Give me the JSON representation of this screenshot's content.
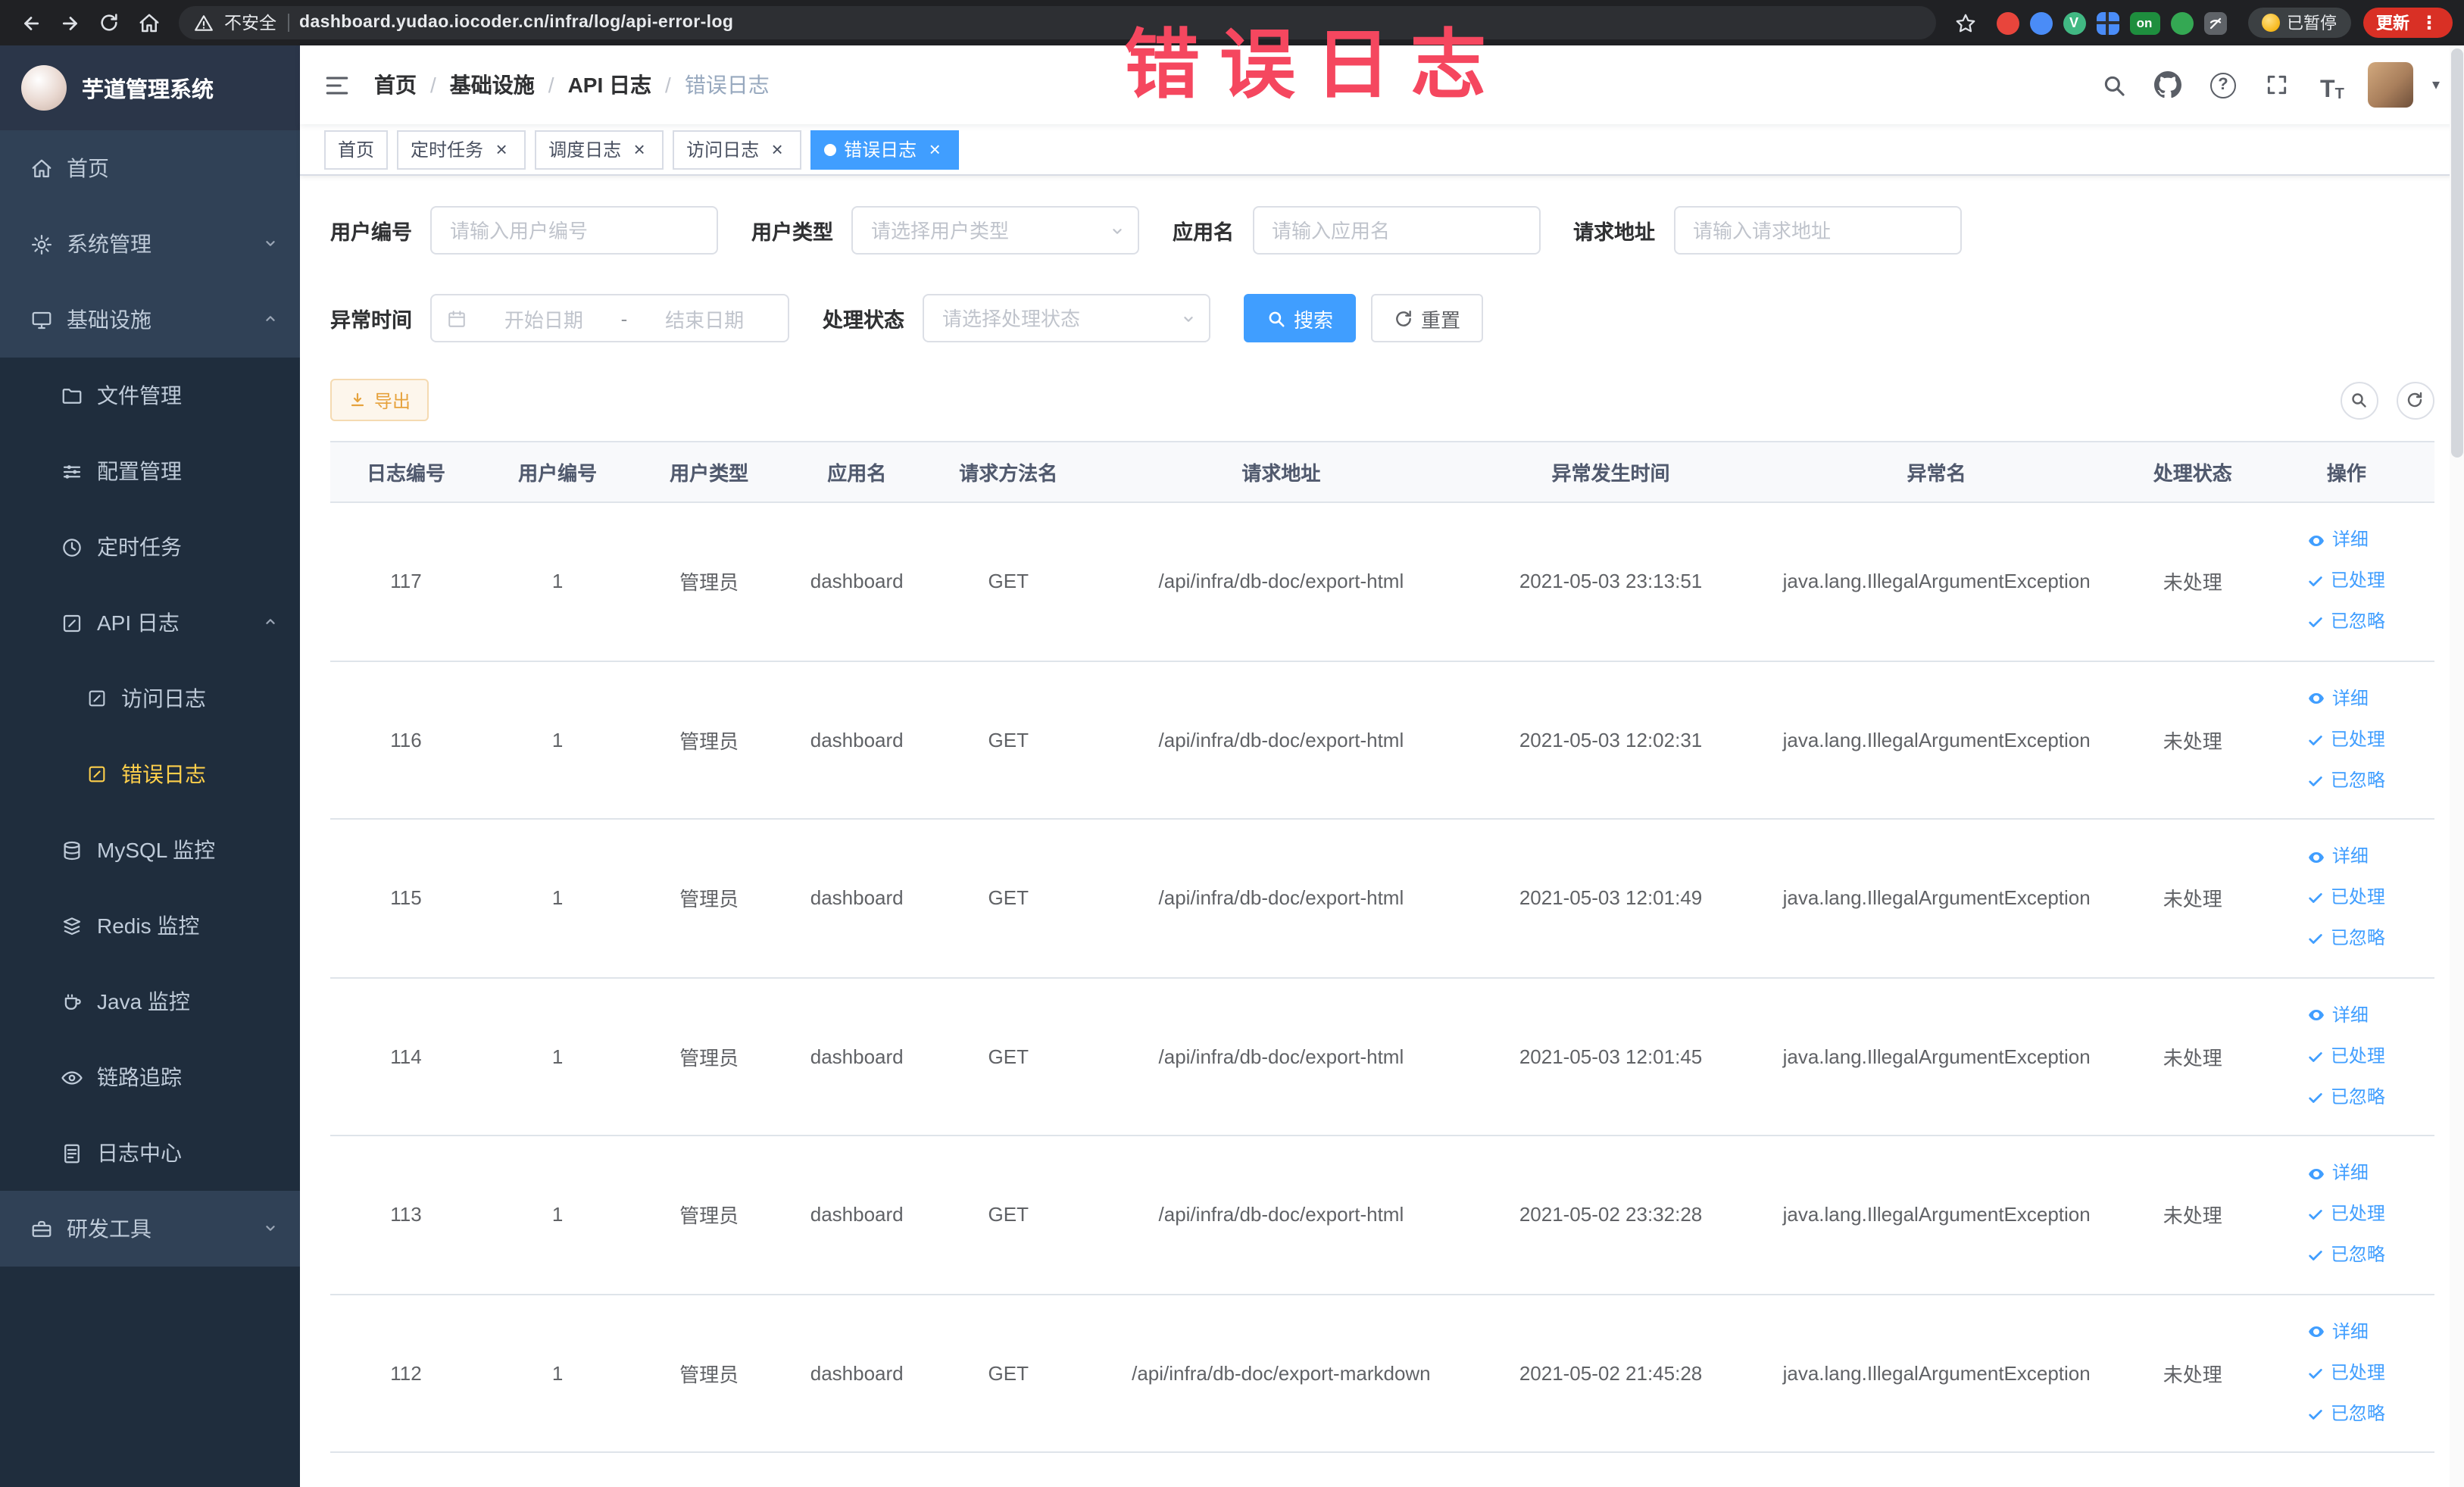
{
  "colors": {
    "accent": "#409eff",
    "warning": "#e6a23c",
    "overlay": "#f5475f",
    "sidebar-active": "#ffd04b"
  },
  "icons": {
    "close": "×",
    "kebab": "⋮",
    "caret_down": "▾",
    "help": "?",
    "text_size_big": "T",
    "text_size_small": "T",
    "vue_letter": "V"
  },
  "browser": {
    "security_label": "不安全",
    "url": "dashboard.yudao.iocoder.cn/infra/log/api-error-log",
    "paused_button": "已暂停",
    "update_button": "更新",
    "extension_badge": "on"
  },
  "overlay": {
    "title": "错误日志"
  },
  "sidebar": {
    "title": "芋道管理系统",
    "items": [
      {
        "label": "首页"
      },
      {
        "label": "系统管理"
      },
      {
        "label": "基础设施"
      },
      {
        "label": "文件管理"
      },
      {
        "label": "配置管理"
      },
      {
        "label": "定时任务"
      },
      {
        "label": "API 日志"
      },
      {
        "label": "访问日志"
      },
      {
        "label": "错误日志"
      },
      {
        "label": "MySQL 监控"
      },
      {
        "label": "Redis 监控"
      },
      {
        "label": "Java 监控"
      },
      {
        "label": "链路追踪"
      },
      {
        "label": "日志中心"
      },
      {
        "label": "研发工具"
      }
    ]
  },
  "breadcrumb": {
    "separator": "/",
    "items": [
      "首页",
      "基础设施",
      "API 日志",
      "错误日志"
    ]
  },
  "tabs": {
    "items": [
      {
        "label": "首页"
      },
      {
        "label": "定时任务"
      },
      {
        "label": "调度日志"
      },
      {
        "label": "访问日志"
      },
      {
        "label": "错误日志"
      }
    ]
  },
  "filters": {
    "user_id": {
      "label": "用户编号",
      "placeholder": "请输入用户编号"
    },
    "user_type": {
      "label": "用户类型",
      "placeholder": "请选择用户类型"
    },
    "app_name": {
      "label": "应用名",
      "placeholder": "请输入应用名"
    },
    "request_url": {
      "label": "请求地址",
      "placeholder": "请输入请求地址"
    },
    "exception_time": {
      "label": "异常时间",
      "start_placeholder": "开始日期",
      "separator": "-",
      "end_placeholder": "结束日期"
    },
    "process_status": {
      "label": "处理状态",
      "placeholder": "请选择处理状态"
    },
    "search_button": "搜索",
    "reset_button": "重置"
  },
  "toolbar": {
    "export_button": "导出"
  },
  "table": {
    "columns": [
      "日志编号",
      "用户编号",
      "用户类型",
      "应用名",
      "请求方法名",
      "请求地址",
      "异常发生时间",
      "异常名",
      "处理状态",
      "操作"
    ],
    "actions": {
      "detail": "详细",
      "processed": "已处理",
      "ignore": "已忽略"
    },
    "rows": [
      {
        "id": "117",
        "user": "1",
        "type": "管理员",
        "app": "dashboard",
        "method": "GET",
        "url": "/api/infra/db-doc/export-html",
        "time": "2021-05-03 23:13:51",
        "exception": "java.lang.IllegalArgumentException",
        "status": "未处理"
      },
      {
        "id": "116",
        "user": "1",
        "type": "管理员",
        "app": "dashboard",
        "method": "GET",
        "url": "/api/infra/db-doc/export-html",
        "time": "2021-05-03 12:02:31",
        "exception": "java.lang.IllegalArgumentException",
        "status": "未处理"
      },
      {
        "id": "115",
        "user": "1",
        "type": "管理员",
        "app": "dashboard",
        "method": "GET",
        "url": "/api/infra/db-doc/export-html",
        "time": "2021-05-03 12:01:49",
        "exception": "java.lang.IllegalArgumentException",
        "status": "未处理"
      },
      {
        "id": "114",
        "user": "1",
        "type": "管理员",
        "app": "dashboard",
        "method": "GET",
        "url": "/api/infra/db-doc/export-html",
        "time": "2021-05-03 12:01:45",
        "exception": "java.lang.IllegalArgumentException",
        "status": "未处理"
      },
      {
        "id": "113",
        "user": "1",
        "type": "管理员",
        "app": "dashboard",
        "method": "GET",
        "url": "/api/infra/db-doc/export-html",
        "time": "2021-05-02 23:32:28",
        "exception": "java.lang.IllegalArgumentException",
        "status": "未处理"
      },
      {
        "id": "112",
        "user": "1",
        "type": "管理员",
        "app": "dashboard",
        "method": "GET",
        "url": "/api/infra/db-doc/export-markdown",
        "time": "2021-05-02 21:45:28",
        "exception": "java.lang.IllegalArgumentException",
        "status": "未处理"
      }
    ]
  }
}
